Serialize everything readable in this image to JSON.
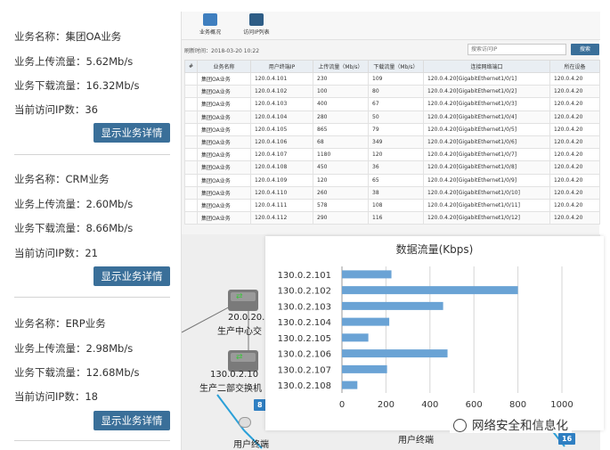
{
  "services": [
    {
      "name_line": "业务名称：集团OA业务",
      "upload_line": "业务上传流量：5.62Mb/s",
      "download_line": "业务下载流量：16.32Mb/s",
      "ip_count_line": "当前访问IP数：36",
      "details_button": "显示业务详情"
    },
    {
      "name_line": "业务名称：CRM业务",
      "upload_line": "业务上传流量：2.60Mb/s",
      "download_line": "业务下载流量：8.66Mb/s",
      "ip_count_line": "当前访问IP数：21",
      "details_button": "显示业务详情"
    },
    {
      "name_line": "业务名称：ERP业务",
      "upload_line": "业务上传流量：2.98Mb/s",
      "download_line": "业务下载流量：12.68Mb/s",
      "ip_count_line": "当前访问IP数：18",
      "details_button": "显示业务详情"
    }
  ],
  "toolbar": {
    "overview_label": "业务概况",
    "ip_list_label": "访问IP列表"
  },
  "refresh": {
    "text": "刷新时间：2018-03-20 10:22"
  },
  "search": {
    "placeholder": "搜索访问IP",
    "button": "搜索"
  },
  "table": {
    "headers": [
      "#",
      "业务名称",
      "用户终端IP",
      "上传流量（Mb/s）",
      "下载流量（Mb/s）",
      "连接网络端口",
      "所在设备"
    ],
    "rows": [
      [
        "",
        "集团OA业务",
        "120.0.4.101",
        "230",
        "109",
        "120.0.4.20[GigabitEthernet1/0/1]",
        "120.0.4.20"
      ],
      [
        "",
        "集团OA业务",
        "120.0.4.102",
        "100",
        "80",
        "120.0.4.20[GigabitEthernet1/0/2]",
        "120.0.4.20"
      ],
      [
        "",
        "集团OA业务",
        "120.0.4.103",
        "400",
        "67",
        "120.0.4.20[GigabitEthernet1/0/3]",
        "120.0.4.20"
      ],
      [
        "",
        "集团OA业务",
        "120.0.4.104",
        "280",
        "50",
        "120.0.4.20[GigabitEthernet1/0/4]",
        "120.0.4.20"
      ],
      [
        "",
        "集团OA业务",
        "120.0.4.105",
        "865",
        "79",
        "120.0.4.20[GigabitEthernet1/0/5]",
        "120.0.4.20"
      ],
      [
        "",
        "集团OA业务",
        "120.0.4.106",
        "68",
        "349",
        "120.0.4.20[GigabitEthernet1/0/6]",
        "120.0.4.20"
      ],
      [
        "",
        "集团OA业务",
        "120.0.4.107",
        "1180",
        "120",
        "120.0.4.20[GigabitEthernet1/0/7]",
        "120.0.4.20"
      ],
      [
        "",
        "集团OA业务",
        "120.0.4.108",
        "450",
        "36",
        "120.0.4.20[GigabitEthernet1/0/8]",
        "120.0.4.20"
      ],
      [
        "",
        "集团OA业务",
        "120.0.4.109",
        "120",
        "65",
        "120.0.4.20[GigabitEthernet1/0/9]",
        "120.0.4.20"
      ],
      [
        "",
        "集团OA业务",
        "120.0.4.110",
        "260",
        "38",
        "120.0.4.20[GigabitEthernet1/0/10]",
        "120.0.4.20"
      ],
      [
        "",
        "集团OA业务",
        "120.0.4.111",
        "578",
        "108",
        "120.0.4.20[GigabitEthernet1/0/11]",
        "120.0.4.20"
      ],
      [
        "",
        "集团OA业务",
        "120.0.4.112",
        "290",
        "116",
        "120.0.4.20[GigabitEthernet1/0/12]",
        "120.0.4.20"
      ]
    ]
  },
  "topology": {
    "switch1_ip": "20.0.20.",
    "switch1_name": "生产中心交",
    "switch2_ip": "130.0.2.10",
    "switch2_name": "生产二部交换机",
    "terminal_label_left": "用户终端",
    "terminal_label_right": "用户终端",
    "badge_left": "8",
    "badge_right": "16"
  },
  "colors": {
    "accent": "#3a6f99",
    "bar": "#6aa3d5",
    "badge": "#2f7fc2"
  },
  "watermark": {
    "text": "网络安全和信息化"
  },
  "chart_data": {
    "type": "bar",
    "orientation": "horizontal",
    "title": "数据流量(Kbps)",
    "categories": [
      "130.0.2.101",
      "130.0.2.102",
      "130.0.2.103",
      "130.0.2.104",
      "130.0.2.105",
      "130.0.2.106",
      "130.0.2.107",
      "130.0.2.108"
    ],
    "values": [
      225,
      800,
      460,
      215,
      120,
      480,
      205,
      70
    ],
    "xlim": [
      0,
      1000
    ],
    "xticks": [
      0,
      200,
      400,
      600,
      800,
      1000
    ],
    "grid": true
  }
}
